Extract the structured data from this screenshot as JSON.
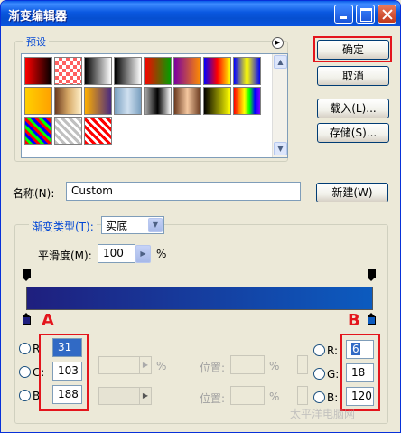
{
  "window": {
    "title": "渐变编辑器"
  },
  "presets": {
    "label": "预设",
    "swatches": [
      "linear-gradient(to right,#ff0000,#000000)",
      "repeating-conic-gradient(#ff6060 0 25%, #ffffff 0 50%) 0 0/8px 8px",
      "linear-gradient(to right,#000000,#ffffff)",
      "linear-gradient(to right,#000000,#ffffff)",
      "linear-gradient(to right,#ff0000,#00a000)",
      "linear-gradient(to right,#7a00a0,#ff8c00)",
      "linear-gradient(to right,#0000ff,#ff0000,#ffff00)",
      "linear-gradient(to right,#0000ff,#ffff00,#0000ff)",
      "linear-gradient(to right,#ffd000,#ffa000)",
      "linear-gradient(to right,#6b3a1f,#d6a866,#fff0c8)",
      "linear-gradient(to right,#ffb000,#4a2a80)",
      "linear-gradient(to right,#7aa0c0,#d0e0f0,#7aa0c0)",
      "linear-gradient(to right,#b0b0b0,#000000,#ffffff)",
      "linear-gradient(to right,#6b3a1f,#f5c8a0,#6b3a1f)",
      "linear-gradient(to right,#000000,#ffff00)",
      "linear-gradient(to right,#ff0000,#ff8000,#ffff00,#00ff00,#0000ff,#8000ff)",
      "repeating-linear-gradient(45deg,#ff0000 0 3px,#00ff00 3px 6px,#0000ff 6px 9px)",
      "repeating-linear-gradient(45deg,#c0c0c0 0 3px,#ffffff 3px 6px)",
      "repeating-linear-gradient(45deg,#ff0000 0 3px,#ffffff 3px 6px)"
    ]
  },
  "buttons": {
    "ok": "确定",
    "cancel": "取消",
    "load": "载入(L)...",
    "save": "存储(S)...",
    "new": "新建(W)"
  },
  "name": {
    "label": "名称(N):",
    "value": "Custom"
  },
  "gradient_type": {
    "label": "渐变类型(T):",
    "value": "实底"
  },
  "smoothness": {
    "label": "平滑度(M):",
    "value": "100",
    "unit": "%"
  },
  "gradient": {
    "start_color": "#1f1f7e",
    "end_color": "#0c5bbf"
  },
  "annotations": {
    "a": "A",
    "b": "B"
  },
  "color_a": {
    "r_label": "R",
    "r": "31",
    "g_label": "G:",
    "g": "103",
    "b_label": "B",
    "b": "188"
  },
  "color_b": {
    "r_label": "R:",
    "r": "6",
    "g_label": "G:",
    "g": "18",
    "b_label": "B:",
    "b": "120"
  },
  "middle": {
    "percent": "%",
    "position_label": "位置:",
    "percent2": "%"
  },
  "watermark": "太平洋电脑网"
}
